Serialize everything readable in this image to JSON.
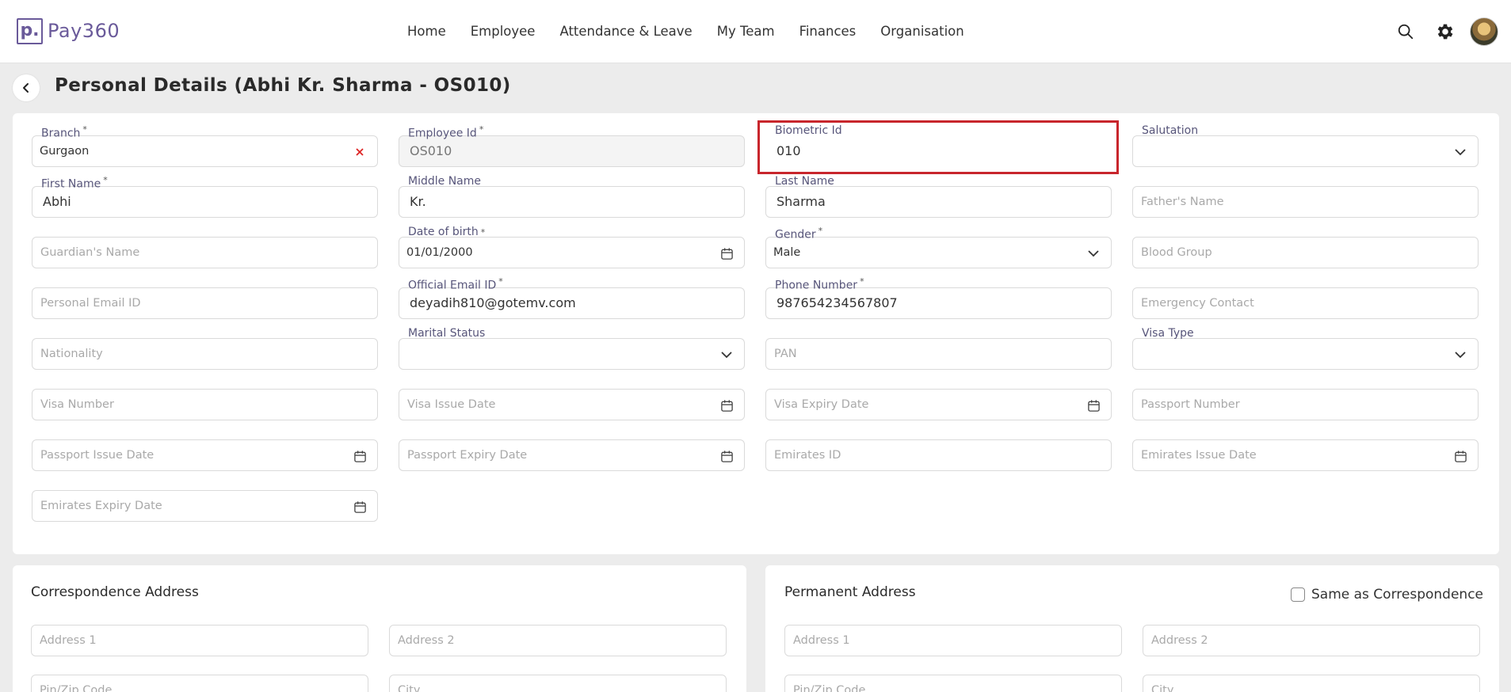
{
  "app": {
    "logo_mark": "p.",
    "logo_text": "Pay360"
  },
  "nav": [
    "Home",
    "Employee",
    "Attendance & Leave",
    "My Team",
    "Finances",
    "Organisation"
  ],
  "page_title": "Personal Details (Abhi Kr. Sharma - OS010)",
  "fields": {
    "branch": {
      "label": "Branch",
      "value": "Gurgaon"
    },
    "employee_id": {
      "label": "Employee Id",
      "value": "OS010"
    },
    "biometric_id": {
      "label": "Biometric Id",
      "value": "010"
    },
    "salutation": {
      "label": "Salutation",
      "value": ""
    },
    "first_name": {
      "label": "First Name",
      "value": "Abhi"
    },
    "middle_name": {
      "label": "Middle Name",
      "value": "Kr."
    },
    "last_name": {
      "label": "Last Name",
      "value": "Sharma"
    },
    "fathers_name": {
      "placeholder": "Father's Name"
    },
    "guardians_name": {
      "placeholder": "Guardian's Name"
    },
    "dob": {
      "label": "Date of birth",
      "value": "01/01/2000"
    },
    "gender": {
      "label": "Gender",
      "value": "Male"
    },
    "blood_group": {
      "placeholder": "Blood Group"
    },
    "personal_email": {
      "placeholder": "Personal Email ID"
    },
    "official_email": {
      "label": "Official Email ID",
      "value": "deyadih810@gotemv.com"
    },
    "phone": {
      "label": "Phone Number",
      "value": "987654234567807"
    },
    "emergency_contact": {
      "placeholder": "Emergency Contact"
    },
    "nationality": {
      "placeholder": "Nationality"
    },
    "marital_status": {
      "label": "Marital Status",
      "value": ""
    },
    "pan": {
      "placeholder": "PAN"
    },
    "visa_type": {
      "label": "Visa Type",
      "value": ""
    },
    "visa_number": {
      "placeholder": "Visa Number"
    },
    "visa_issue_date": {
      "placeholder": "Visa Issue Date"
    },
    "visa_expiry_date": {
      "placeholder": "Visa Expiry Date"
    },
    "passport_number": {
      "placeholder": "Passport Number"
    },
    "passport_issue_date": {
      "placeholder": "Passport Issue Date"
    },
    "passport_expiry_date": {
      "placeholder": "Passport Expiry Date"
    },
    "emirates_id": {
      "placeholder": "Emirates ID"
    },
    "emirates_issue_date": {
      "placeholder": "Emirates Issue Date"
    },
    "emirates_expiry_date": {
      "placeholder": "Emirates Expiry Date"
    }
  },
  "correspondence": {
    "title": "Correspondence Address",
    "address1": "Address 1",
    "address2": "Address 2",
    "pin": "Pin/Zip Code",
    "city": "City"
  },
  "permanent": {
    "title": "Permanent Address",
    "same_as": "Same as Correspondence",
    "address1": "Address 1",
    "address2": "Address 2",
    "pin": "Pin/Zip Code",
    "city": "City"
  },
  "colors": {
    "brand": "#6a5a9a",
    "highlight": "#c8262c",
    "label": "#57557a"
  }
}
